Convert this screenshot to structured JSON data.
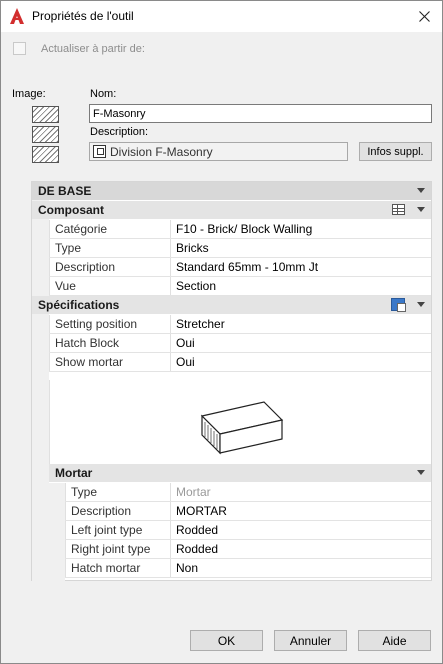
{
  "window": {
    "title": "Propriétés de l'outil"
  },
  "update": {
    "label": "Actualiser à partir de:"
  },
  "labels": {
    "image": "Image:",
    "nom": "Nom:",
    "description": "Description:"
  },
  "fields": {
    "nom": "F-Masonry",
    "description": "Division F-Masonry",
    "infos_button": "Infos suppl."
  },
  "sections": {
    "debase": "DE BASE",
    "composant": "Composant",
    "specifications": "Spécifications",
    "mortar": "Mortar"
  },
  "composant_rows": [
    {
      "label": "Catégorie",
      "value": "F10 - Brick/ Block Walling"
    },
    {
      "label": "Type",
      "value": "Bricks"
    },
    {
      "label": "Description",
      "value": "Standard 65mm - 10mm Jt"
    },
    {
      "label": "Vue",
      "value": "Section"
    }
  ],
  "spec_rows": [
    {
      "label": "Setting position",
      "value": "Stretcher"
    },
    {
      "label": "Hatch Block",
      "value": "Oui"
    },
    {
      "label": "Show mortar",
      "value": "Oui"
    }
  ],
  "mortar_rows": [
    {
      "label": "Type",
      "value": "Mortar"
    },
    {
      "label": "Description",
      "value": "MORTAR"
    },
    {
      "label": "Left joint type",
      "value": "Rodded"
    },
    {
      "label": "Right joint type",
      "value": "Rodded"
    },
    {
      "label": "Hatch mortar",
      "value": "Non"
    }
  ],
  "buttons": {
    "ok": "OK",
    "cancel": "Annuler",
    "help": "Aide"
  },
  "colors": {
    "app_icon": "#d22e2e",
    "spec_icon": "#3a78c9"
  }
}
